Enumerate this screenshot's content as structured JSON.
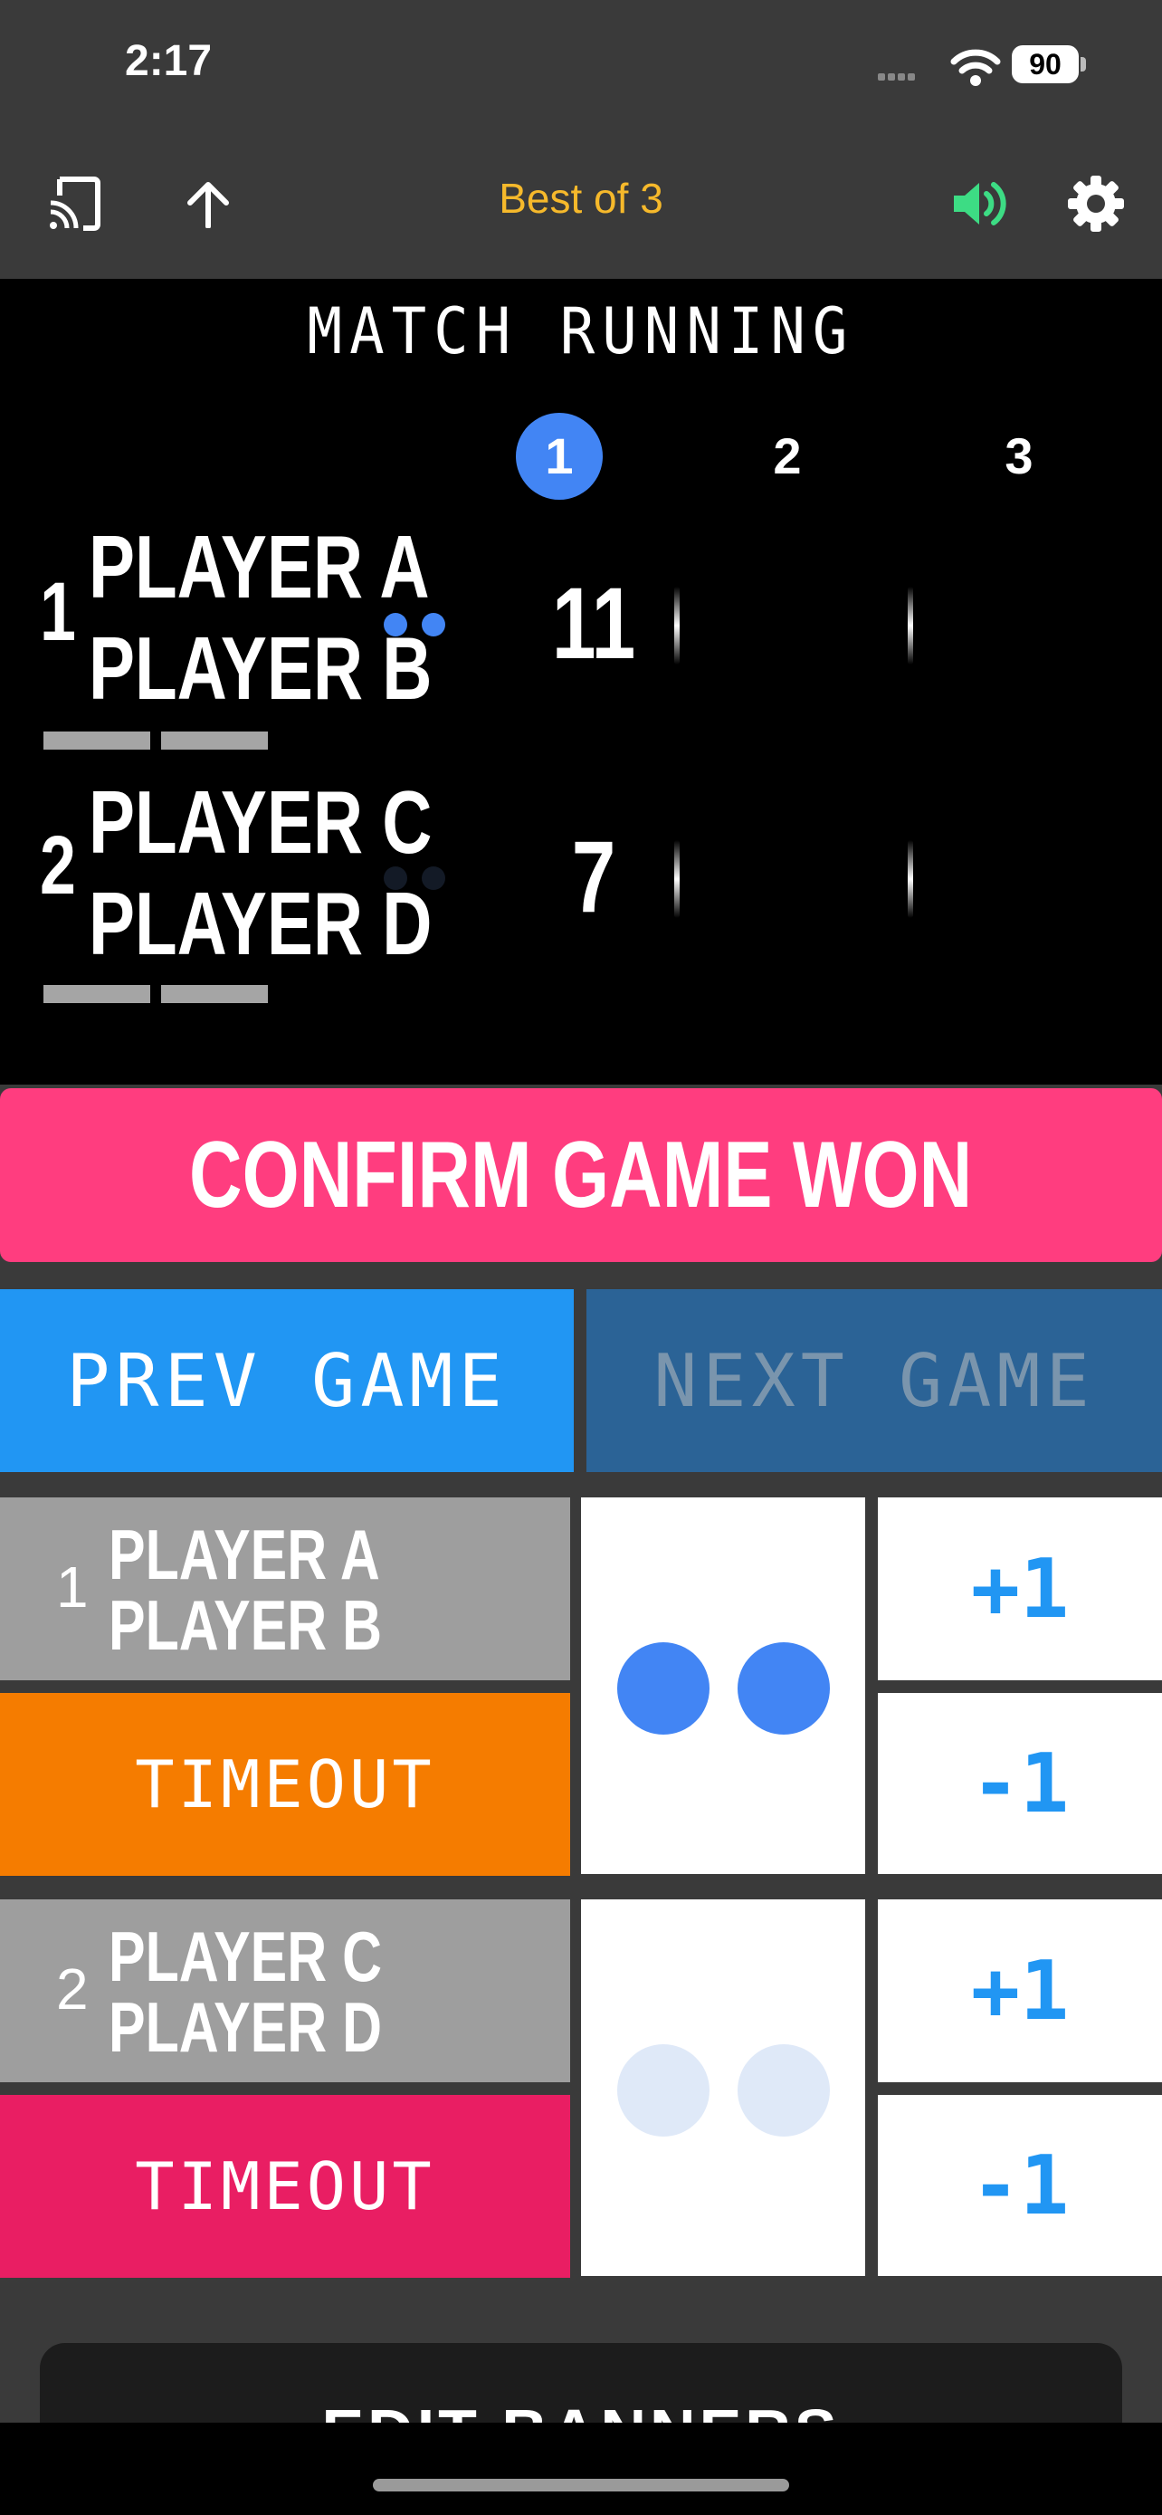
{
  "status_bar": {
    "time": "2:17",
    "battery": "90"
  },
  "header": {
    "title": "Best of 3"
  },
  "scoreboard": {
    "status": "MATCH RUNNING",
    "game_numbers": [
      "1",
      "2",
      "3"
    ],
    "active_game": 1,
    "teams": [
      {
        "number": "1",
        "player1": "PLAYER A",
        "player2": "PLAYER B",
        "scores": [
          "11",
          "",
          ""
        ],
        "serving": true
      },
      {
        "number": "2",
        "player1": "PLAYER C",
        "player2": "PLAYER D",
        "scores": [
          "7",
          "",
          ""
        ],
        "serving": false
      }
    ]
  },
  "actions": {
    "confirm": "CONFIRM GAME WON",
    "prev_game": "PREV GAME",
    "next_game": "NEXT GAME"
  },
  "controls": [
    {
      "number": "1",
      "player1": "PLAYER A",
      "player2": "PLAYER B",
      "timeout": "TIMEOUT",
      "plus": "+1",
      "minus": "-1",
      "timeout_color": "#f57c00",
      "serving": true
    },
    {
      "number": "2",
      "player1": "PLAYER C",
      "player2": "PLAYER D",
      "timeout": "TIMEOUT",
      "plus": "+1",
      "minus": "-1",
      "timeout_color": "#e91e63",
      "serving": false
    }
  ],
  "bottom": {
    "edit_label": "EDIT BANNERS"
  },
  "colors": {
    "accent_blue": "#2196f3",
    "serve_dot_active": "#4285f4",
    "serve_dot_inactive": "#dfe9f8",
    "confirm_pink": "#ff3d7f",
    "title_gold": "#f6b92b",
    "sound_green": "#3ddc84"
  },
  "icons": [
    "cast-icon",
    "share-icon",
    "sound-icon",
    "gear-icon"
  ]
}
